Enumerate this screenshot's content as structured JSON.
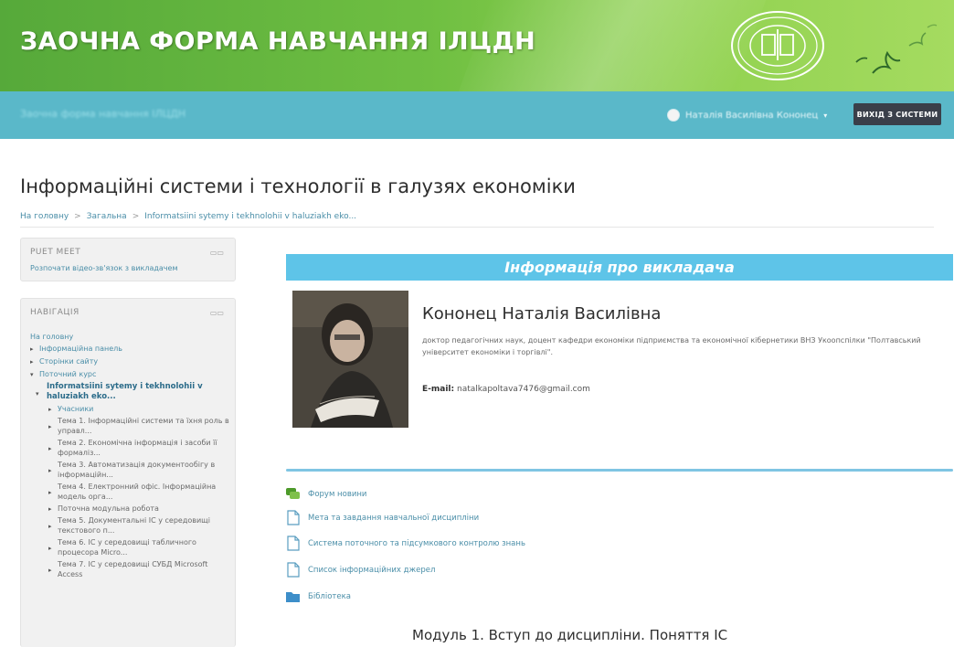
{
  "header": {
    "site_title": "ЗАОЧНА ФОРМА НАВЧАННЯ ІЛЦДН"
  },
  "navbar": {
    "user_name": "Наталія Василівна Кононец",
    "logout_label": "ВИХІД З СИСТЕМИ"
  },
  "page": {
    "title": "Інформаційні системи і технології в галузях економіки",
    "breadcrumb": [
      "На головну",
      "Загальна",
      "Informatsiini sytemy i tekhnolohii v haluziakh eko..."
    ],
    "breadcrumb_separator": ">"
  },
  "blocks": {
    "meet": {
      "header": "PUET MEET",
      "link": "Розпочати відео-зв'язок з викладачем"
    },
    "navigation": {
      "header": "НАВІГАЦІЯ",
      "items": [
        {
          "label": "На головну",
          "marker": ""
        },
        {
          "label": "Інформаційна панель",
          "marker": "▸"
        },
        {
          "label": "Сторінки сайту",
          "marker": "▸"
        },
        {
          "label": "Поточний курс",
          "marker": "▾"
        },
        {
          "label": "Informatsiini sytemy i tekhnolohii v haluziakh eko...",
          "marker": "▾"
        },
        {
          "label": "Учасники",
          "marker": "▸"
        },
        {
          "label": "Тема 1. Інформаційні системи та їхня роль в управл...",
          "marker": "▸"
        },
        {
          "label": "Тема 2. Економічна інформація і засоби її формаліз...",
          "marker": "▸"
        },
        {
          "label": "Тема 3. Автоматизація документообігу в інформаційн...",
          "marker": "▸"
        },
        {
          "label": "Тема 4. Електронний офіс. Інформаційна модель орга...",
          "marker": "▸"
        },
        {
          "label": "Поточна модульна робота",
          "marker": "▸"
        },
        {
          "label": "Тема 5. Документальні ІС у середовищі текстового п...",
          "marker": "▸"
        },
        {
          "label": "Тема 6. ІС у середовищі табличного процесора Micro...",
          "marker": "▸"
        },
        {
          "label": "Тема 7. ІС у середовищі СУБД Microsoft Access",
          "marker": "▸"
        }
      ]
    }
  },
  "main": {
    "info_banner": "Інформація про викладача",
    "teacher": {
      "name": "Кононец Наталія Василівна",
      "description": "доктор педагогічних наук, доцент кафедри економіки підприємства та економічної кібернетики ВНЗ Укоопспілки \"Полтавський університет економіки і торгівлі\".",
      "email_label": "E-mail:",
      "email": "natalkapoltava7476@gmail.com"
    },
    "resources": [
      {
        "label": "Форум новини",
        "icon": "forum-icon"
      },
      {
        "label": "Мета та завдання навчальної дисципліни",
        "icon": "file-icon"
      },
      {
        "label": "Система поточного та підсумкового контролю знань",
        "icon": "file-icon"
      },
      {
        "label": "Список інформаційних джерел",
        "icon": "file-icon"
      },
      {
        "label": "Бібліотека",
        "icon": "folder-icon"
      }
    ],
    "module_title": "Модуль 1. Вступ до дисципліни. Поняття ІС"
  },
  "colors": {
    "banner_green": "#6fbf42",
    "navbar_teal": "#5ab8c9",
    "info_banner": "#5ec4e8",
    "link_blue": "#4a8ea8"
  }
}
